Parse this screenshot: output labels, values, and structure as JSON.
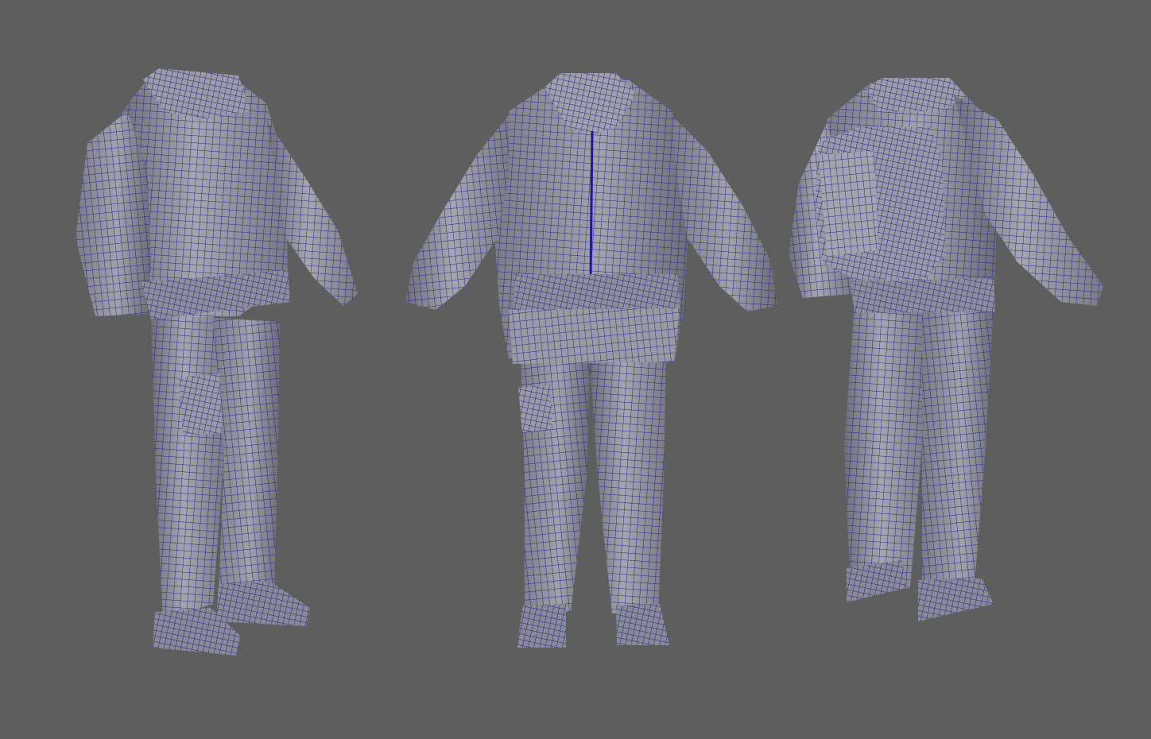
{
  "viewport": {
    "background_color": "#5e5e5e",
    "mesh_fill_color": "#8d8d96",
    "mesh_shade_color": "#6f6f7a",
    "mesh_highlight_color": "#a6a6ae",
    "wireframe_color": "#1a1a9c"
  },
  "models": [
    {
      "view": "three-quarter-front",
      "has_backpack": false
    },
    {
      "view": "front",
      "has_backpack": false
    },
    {
      "view": "three-quarter-back",
      "has_backpack": true
    }
  ]
}
